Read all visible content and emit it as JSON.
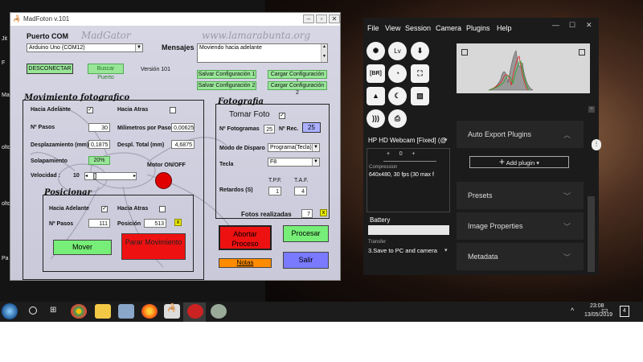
{
  "desktop": {
    "labels": [
      "Jit",
      "F",
      "Mac",
      "oltc",
      "oltc",
      "Pa"
    ]
  },
  "madfoton": {
    "title": "MadFoton v.101",
    "watermark_left": "MadGator",
    "watermark_right": "www.lamarabunta.org",
    "puerto_com": {
      "label": "Puerto COM",
      "selected": "Arduino Uno (COM12)",
      "desconectar": "DESCONECTAR",
      "buscar": "Buscar Puerto",
      "version": "Versión 101"
    },
    "mensajes": {
      "label": "Mensajes",
      "value": "Moviendo hacia adelante"
    },
    "config_buttons": [
      "Salvar Configuración 1",
      "Cargar Configuración 1",
      "Salvar Configuración 2",
      "Cargar Configuración 2"
    ],
    "movimiento": {
      "title": "Movimiento fotografico",
      "hacia_adelante": "Hacia Adelante",
      "hacia_adelante_checked": "✓",
      "hacia_atras": "Hacia Atras",
      "n_pasos_label": "Nº Pasos",
      "n_pasos": "30",
      "mm_por_paso_label": "Milimetros por Paso",
      "mm_por_paso": "0,00625",
      "desplazamiento_label": "Desplazamiento (mm)",
      "desplazamiento": "0,1875",
      "despl_total_label": "Despl. Total (mm)",
      "despl_total": "4,6875",
      "solapamiento_label": "Solapamiento",
      "solapamiento": "20%",
      "motor_label": "Motor ON/OFF",
      "velocidad_label": "Velocidad :",
      "velocidad": "10"
    },
    "posicionar": {
      "title": "Posicionar",
      "hacia_adelante": "Hacia Adelante",
      "hacia_adelante_checked": "✓",
      "hacia_atras": "Hacia Atras",
      "n_pasos_label": "Nº Pasos",
      "n_pasos": "111",
      "posicion_label": "Posición",
      "posicion": "513",
      "x_btn": "x",
      "mover": "Mover",
      "parar": "Parar Movimiento"
    },
    "fotografia": {
      "title": "Fotografia",
      "tomar_foto": "Tomar Foto",
      "tomar_foto_checked": "✓",
      "n_fotogramas_label": "Nº Fotogramas",
      "n_fotogramas": "25",
      "n_rec_label": "Nº Rec.",
      "n_rec": "25",
      "modo_label": "Modo de Disparo",
      "modo": "Programa(Tecla)",
      "tecla_label": "Tecla",
      "tecla": "F8",
      "tpf_label": "T.P.F.",
      "taf_label": "T.A.F.",
      "retardos_label": "Retardos (S)",
      "tpf": "1",
      "taf": "4"
    },
    "fotos_realizadas_label": "Fotos realizadas",
    "fotos_realizadas": "7",
    "fotos_x": "x",
    "abortar": "Abortar Proceso",
    "procesar": "Procesar",
    "notas": "Notas",
    "salir": "Salir",
    "colors": {
      "green_btn": "#77ee77",
      "red_btn": "#ee1111",
      "orange_btn": "#ff8c00",
      "blue_btn": "#7a7aff",
      "motor_led": "#e00000"
    }
  },
  "capture": {
    "menu": [
      "File",
      "View",
      "Session",
      "Camera",
      "Plugins",
      "Help"
    ],
    "tool_icons": [
      "aperture-icon",
      "lv-icon",
      "download-icon",
      "br-icon",
      "timer-icon",
      "focus-icon",
      "image-icon",
      "night-icon",
      "gallery-icon",
      "wireless-icon",
      "print-icon"
    ],
    "lv_label": "Lv",
    "br_label": "[BR]",
    "camera": "HP HD Webcam [Fixed] (@",
    "exposure_ticks": [
      "+",
      "0",
      "+"
    ],
    "compression_label": "Compression",
    "compression": "640x480, 30 fps (30 max f",
    "battery_label": "Battery",
    "transfer_label": "Transfer",
    "transfer": "3.Save to PC and camera",
    "panels": [
      "Auto Export Plugins",
      "Presets",
      "Image Properties",
      "Metadata"
    ],
    "add_plugin": "Add plugin"
  },
  "taskbar": {
    "time": "23:08",
    "date": "13/05/2019",
    "notifications": "4"
  }
}
